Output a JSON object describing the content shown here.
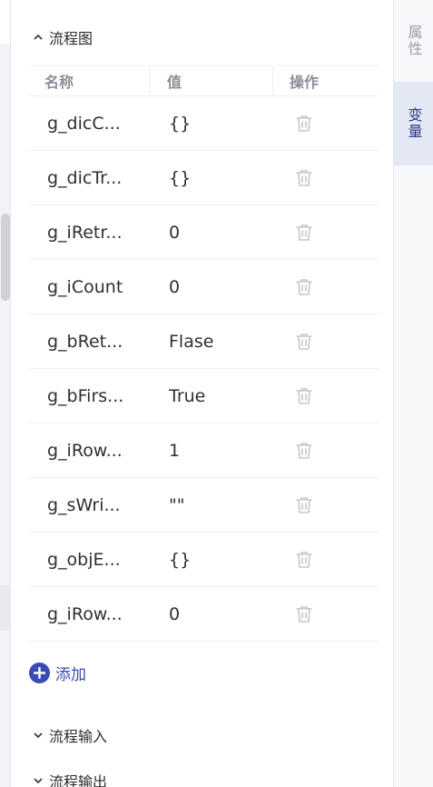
{
  "sections": {
    "flowchart": {
      "title": "流程图",
      "expanded": true
    },
    "flow_input": {
      "title": "流程输入",
      "expanded": false
    },
    "flow_output": {
      "title": "流程输出",
      "expanded": false
    }
  },
  "table": {
    "headers": [
      "名称",
      "值",
      "操作"
    ],
    "rows": [
      {
        "name": "g_dicC...",
        "value": "{}"
      },
      {
        "name": "g_dicTr...",
        "value": "{}"
      },
      {
        "name": "g_iRetr...",
        "value": "0"
      },
      {
        "name": "g_iCount",
        "value": "0"
      },
      {
        "name": "g_bRet...",
        "value": "Flase"
      },
      {
        "name": "g_bFirs...",
        "value": "True"
      },
      {
        "name": "g_iRow...",
        "value": "1"
      },
      {
        "name": "g_sWri...",
        "value": "\"\""
      },
      {
        "name": "g_objE...",
        "value": "{}"
      },
      {
        "name": "g_iRow...",
        "value": "0"
      }
    ]
  },
  "add_button": {
    "label": "添加"
  },
  "right_tabs": [
    {
      "label": "属性",
      "active": false
    },
    {
      "label": "变量",
      "active": true
    }
  ],
  "colors": {
    "accent": "#3a4bb3",
    "active_tab_bg": "#e4e7f4",
    "header_text": "#8a8e99",
    "trash_icon": "#c4c7ce"
  },
  "icons": {
    "section_expand": "chevron-up-icon",
    "section_collapse": "chevron-down-icon",
    "row_action": "trash-icon",
    "add": "plus-circle-icon"
  }
}
